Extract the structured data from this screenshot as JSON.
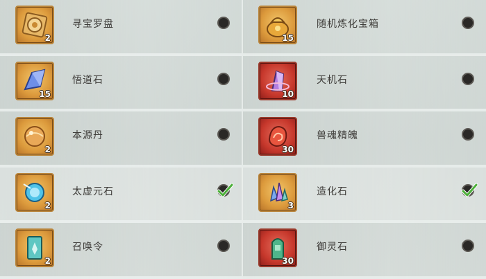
{
  "items": [
    {
      "name": "寻宝罗盘",
      "count": "2",
      "frame": "gold",
      "icon": "compass-icon",
      "selected": false
    },
    {
      "name": "随机炼化宝箱",
      "count": "15",
      "frame": "gold",
      "icon": "treasure-bag-icon",
      "selected": false
    },
    {
      "name": "悟道石",
      "count": "15",
      "frame": "gold",
      "icon": "blue-crystal-icon",
      "selected": false
    },
    {
      "name": "天机石",
      "count": "10",
      "frame": "red",
      "icon": "purple-crystal-icon",
      "selected": false
    },
    {
      "name": "本源丹",
      "count": "2",
      "frame": "gold",
      "icon": "orb-icon",
      "selected": false
    },
    {
      "name": "兽魂精魄",
      "count": "30",
      "frame": "red",
      "icon": "beast-soul-icon",
      "selected": false
    },
    {
      "name": "太虚元石",
      "count": "2",
      "frame": "gold",
      "icon": "blue-orb-icon",
      "selected": true
    },
    {
      "name": "造化石",
      "count": "3",
      "frame": "gold",
      "icon": "crystal-cluster-icon",
      "selected": true
    },
    {
      "name": "召唤令",
      "count": "2",
      "frame": "gold",
      "icon": "summon-token-icon",
      "selected": false
    },
    {
      "name": "御灵石",
      "count": "30",
      "frame": "red",
      "icon": "jade-stone-icon",
      "selected": false
    }
  ],
  "colors": {
    "gold_frame": "#dc9a3c",
    "red_frame": "#c7382c",
    "check": "#4caf3a",
    "text": "#3d3b38"
  }
}
